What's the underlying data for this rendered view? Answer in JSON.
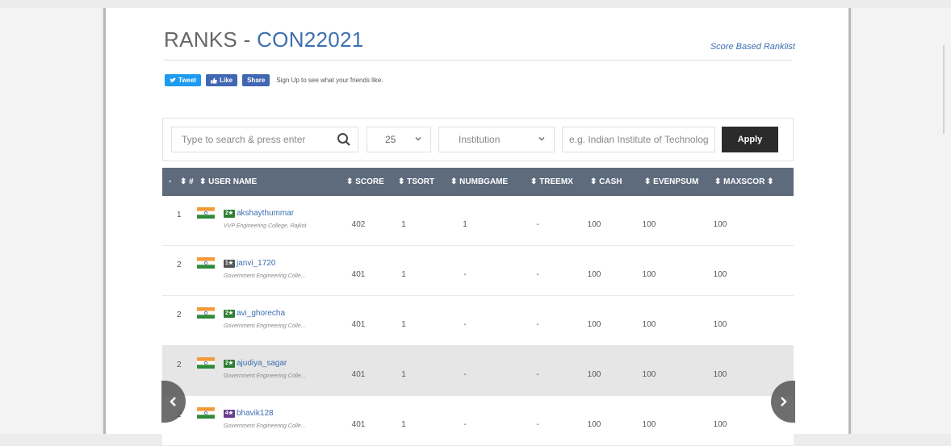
{
  "header": {
    "title_prefix": "RANKS - ",
    "contest_code": "CON22021",
    "ranklist_link": "Score Based Ranklist"
  },
  "social": {
    "tweet": "Tweet",
    "like": "Like",
    "share": "Share",
    "signup_text": "Sign Up to see what your friends like."
  },
  "filters": {
    "search_placeholder": "Type to search & press enter",
    "rows_value": "25",
    "filter_type": "Institution",
    "institution_placeholder": "e.g. Indian Institute of Technolog",
    "apply_label": "Apply"
  },
  "table": {
    "columns": [
      "#",
      "USER NAME",
      "SCORE",
      "TSORT",
      "NUMBGAME",
      "TREEMX",
      "CASH",
      "EVENPSUM",
      "MAXSCOR"
    ],
    "rows": [
      {
        "rank": "1",
        "badge": "2★",
        "badge_color": "#2e7d32",
        "user": "akshaythummar",
        "institution": "VVP Engineering College, Rajkot",
        "score": "402",
        "tsort": "1",
        "numbgame": "1",
        "treemx": "-",
        "cash": "100",
        "evenpsum": "100",
        "maxscor": "100"
      },
      {
        "rank": "2",
        "badge": "1★",
        "badge_color": "#555555",
        "user": "janvi_1720",
        "institution": "Government Engineering Colle...",
        "score": "401",
        "tsort": "1",
        "numbgame": "-",
        "treemx": "-",
        "cash": "100",
        "evenpsum": "100",
        "maxscor": "100"
      },
      {
        "rank": "2",
        "badge": "2★",
        "badge_color": "#2e7d32",
        "user": "avi_ghorecha",
        "institution": "Government Engineering Colle...",
        "score": "401",
        "tsort": "1",
        "numbgame": "-",
        "treemx": "-",
        "cash": "100",
        "evenpsum": "100",
        "maxscor": "100"
      },
      {
        "rank": "2",
        "badge": "2★",
        "badge_color": "#2e7d32",
        "user": "ajudiya_sagar",
        "institution": "Government Engineering Colle...",
        "score": "401",
        "tsort": "1",
        "numbgame": "-",
        "treemx": "-",
        "cash": "100",
        "evenpsum": "100",
        "maxscor": "100"
      },
      {
        "rank": "2",
        "badge": "4★",
        "badge_color": "#6a3d8f",
        "user": "bhavik128",
        "institution": "Government Engineering Colle...",
        "score": "401",
        "tsort": "1",
        "numbgame": "-",
        "treemx": "-",
        "cash": "100",
        "evenpsum": "100",
        "maxscor": "100"
      }
    ]
  },
  "icons": {
    "search": "search-icon",
    "chevron": "chevron-down-icon",
    "flag": "india-flag-icon",
    "prev": "chevron-left-icon",
    "next": "chevron-right-icon"
  }
}
